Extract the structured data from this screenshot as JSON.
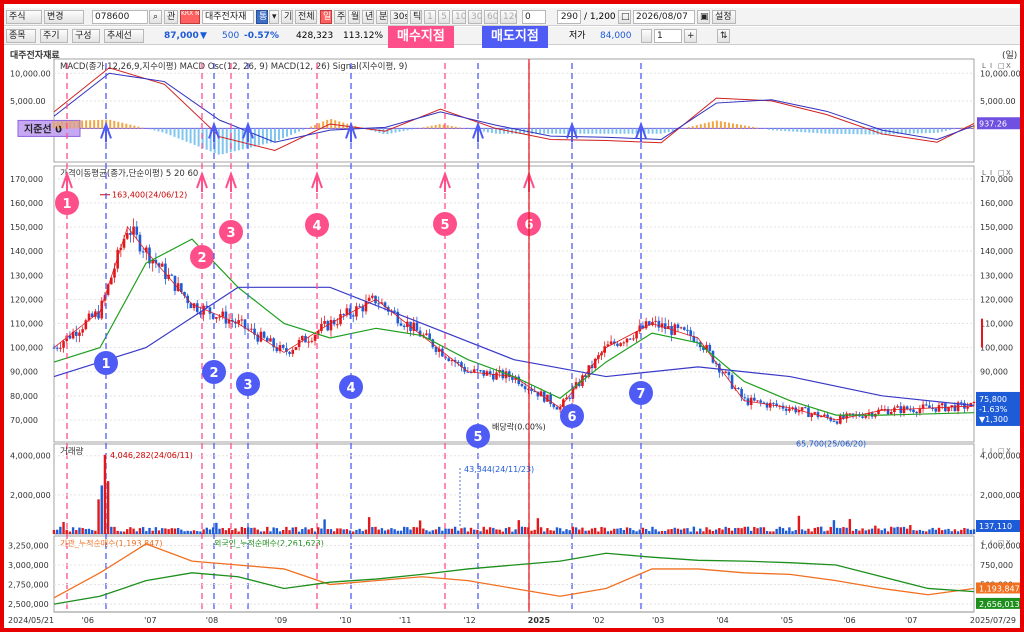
{
  "toolbar1": {
    "market": "주식",
    "change_btn": "변경",
    "code": "078600",
    "code_icon": "search-icon",
    "ref_btn": "관",
    "mode_btn": "KRX NXT",
    "stock_name": "대주전자재",
    "inc_btn": "통",
    "gi_btn": "기",
    "all_btn": "전체",
    "periods": [
      "일",
      "주",
      "월",
      "년",
      "분",
      "30s",
      "틱",
      "1",
      "5",
      "10",
      "30",
      "60",
      "120"
    ],
    "zero_val": "0",
    "count_val": "290",
    "total_val": "/ 1,200",
    "date_val": "2026/08/07",
    "settings_btn": "설정"
  },
  "toolbar2": {
    "tabs": [
      "종목",
      "주기",
      "구성",
      "추세선"
    ],
    "price": "87,000",
    "price_arrow": "▼",
    "change": "500",
    "change_pct": "-0.57%",
    "volume": "428,323",
    "vol_ratio": "113.12%",
    "low_label": "저가",
    "low_value": "84,000",
    "qty": "1"
  },
  "banners": {
    "buy": "매수지점",
    "sell": "매도지점"
  },
  "subtitle": {
    "name": "대주전자재료",
    "unit": "(일)"
  },
  "colors": {
    "buy": "#ff4f8b",
    "sell": "#4f5bf5",
    "up": "#e1191c",
    "down": "#1e5bd6",
    "ma5": "#e1191c",
    "ma20": "#20a020",
    "ma60": "#3a3ac8",
    "inst": "#f07022",
    "foreign": "#1d8f1d"
  },
  "chart_data": [
    {
      "type": "line",
      "panel": "macd",
      "title": "MACD(종가,12,26,9,지수이평) MACD Osc(12, 26, 9) MACD(12, 26) Signal(지수이평, 9)",
      "y_ticks": [
        "10,000.00",
        "5,000.00"
      ],
      "zero_label": "지준선 0",
      "last_value": "937.26",
      "x": [
        0,
        0.06,
        0.12,
        0.18,
        0.24,
        0.3,
        0.36,
        0.42,
        0.48,
        0.54,
        0.6,
        0.66,
        0.72,
        0.78,
        0.84,
        0.9,
        0.96,
        1.0
      ],
      "series": [
        {
          "name": "MACD(12, 26)",
          "values": [
            3000,
            11000,
            8000,
            -1500,
            -4000,
            800,
            -500,
            3500,
            0,
            -2000,
            -2200,
            -2600,
            5500,
            5000,
            2500,
            -1000,
            -2500,
            900
          ]
        },
        {
          "name": "Signal(지수이평, 9)",
          "values": [
            2200,
            10000,
            8500,
            1500,
            -2500,
            -300,
            200,
            3000,
            600,
            -1400,
            -1600,
            -2000,
            4600,
            5200,
            3100,
            -300,
            -2000,
            500
          ]
        }
      ]
    },
    {
      "type": "bar",
      "panel": "price",
      "title": "가격이동평균(종가,단순이평) 5 20 60",
      "y_ticks": [
        "170,000",
        "160,000",
        "150,000",
        "140,000",
        "130,000",
        "120,000",
        "110,000",
        "100,000",
        "90,000",
        "80,000",
        "70,000"
      ],
      "y_range": [
        65000,
        172000
      ],
      "annotations": [
        "163,400(24/06/12)",
        "65,700(25/06/20)",
        "배당락(0.00%)"
      ],
      "last_price": "75,800",
      "last_pct": "-1.63%",
      "last_change": "▼1,300",
      "ma": [
        {
          "name": "5",
          "x": [
            0,
            0.05,
            0.08,
            0.1,
            0.15,
            0.2,
            0.25,
            0.3,
            0.35,
            0.4,
            0.45,
            0.5,
            0.55,
            0.6,
            0.65,
            0.7,
            0.75,
            0.8,
            0.85,
            0.9,
            1.0
          ],
          "values": [
            100000,
            115000,
            150000,
            140000,
            118000,
            110000,
            98000,
            110000,
            120000,
            105000,
            90000,
            88000,
            75000,
            100000,
            110000,
            104000,
            78000,
            75000,
            70000,
            74000,
            75800
          ]
        },
        {
          "name": "20",
          "x": [
            0,
            0.05,
            0.1,
            0.15,
            0.2,
            0.25,
            0.3,
            0.35,
            0.4,
            0.45,
            0.5,
            0.55,
            0.6,
            0.65,
            0.7,
            0.75,
            0.8,
            0.85,
            0.9,
            1.0
          ],
          "values": [
            94000,
            100000,
            135000,
            145000,
            125000,
            110000,
            104000,
            108000,
            105000,
            95000,
            88000,
            79000,
            94000,
            106000,
            102000,
            86000,
            78000,
            72000,
            72000,
            73000
          ]
        },
        {
          "name": "60",
          "x": [
            0,
            0.1,
            0.2,
            0.3,
            0.4,
            0.5,
            0.6,
            0.7,
            0.8,
            0.9,
            1.0
          ],
          "values": [
            88000,
            100000,
            125000,
            125000,
            110000,
            95000,
            88000,
            92000,
            88000,
            80000,
            76000
          ]
        }
      ],
      "buy_signals": [
        "1",
        "2",
        "3",
        "4",
        "5",
        "6"
      ],
      "sell_signals": [
        "1",
        "2",
        "3",
        "4",
        "5",
        "6",
        "7"
      ]
    },
    {
      "type": "bar",
      "panel": "volume",
      "title": "거래량",
      "y_ticks": [
        "4,000,000",
        "2,000,000"
      ],
      "annotations": [
        "4,046,282(24/06/11)",
        "43,344(24/11/23)"
      ],
      "last_value": "137,110"
    },
    {
      "type": "line",
      "panel": "flow",
      "title": "기관_누적순매수(1,193,847)",
      "title2": "외국인_누적순매수(2,261,623)",
      "y_ticks_left": [
        "3,250,000",
        "3,000,000",
        "2,750,000",
        "2,500,000"
      ],
      "y_ticks_right": [
        "1,000,000",
        "750,000",
        "500,000",
        "250,000"
      ],
      "right_labels": [
        "1,193,847",
        "2,656,013"
      ],
      "x": [
        0,
        0.05,
        0.1,
        0.15,
        0.2,
        0.25,
        0.3,
        0.35,
        0.4,
        0.45,
        0.5,
        0.55,
        0.6,
        0.65,
        0.7,
        0.75,
        0.8,
        0.85,
        0.9,
        0.95,
        1.0
      ],
      "series": [
        {
          "name": "기관_누적순매수(1,193,847)",
          "values": [
            2580000,
            2900000,
            3270000,
            3050000,
            3000000,
            2950000,
            2750000,
            2800000,
            2850000,
            2800000,
            2700000,
            2600000,
            2700000,
            2950000,
            2950000,
            2900000,
            2880000,
            2800000,
            2700000,
            2620000,
            2700000
          ]
        },
        {
          "name": "외국인_누적순매수(2,261,623)",
          "values": [
            2500000,
            2600000,
            2800000,
            2900000,
            2850000,
            2700000,
            2780000,
            2820000,
            2880000,
            2950000,
            3000000,
            3050000,
            3150000,
            3100000,
            3060000,
            3050000,
            3030000,
            3000000,
            2850000,
            2700000,
            2660000
          ]
        }
      ]
    }
  ],
  "xaxis": {
    "labels": [
      "2024/05/21",
      "'06",
      "'07",
      "'08",
      "'09",
      "'10",
      "'11",
      "'12",
      "2025",
      "'02",
      "'03",
      "'04",
      "'05",
      "'06",
      "'07",
      "2025/07/29"
    ]
  }
}
